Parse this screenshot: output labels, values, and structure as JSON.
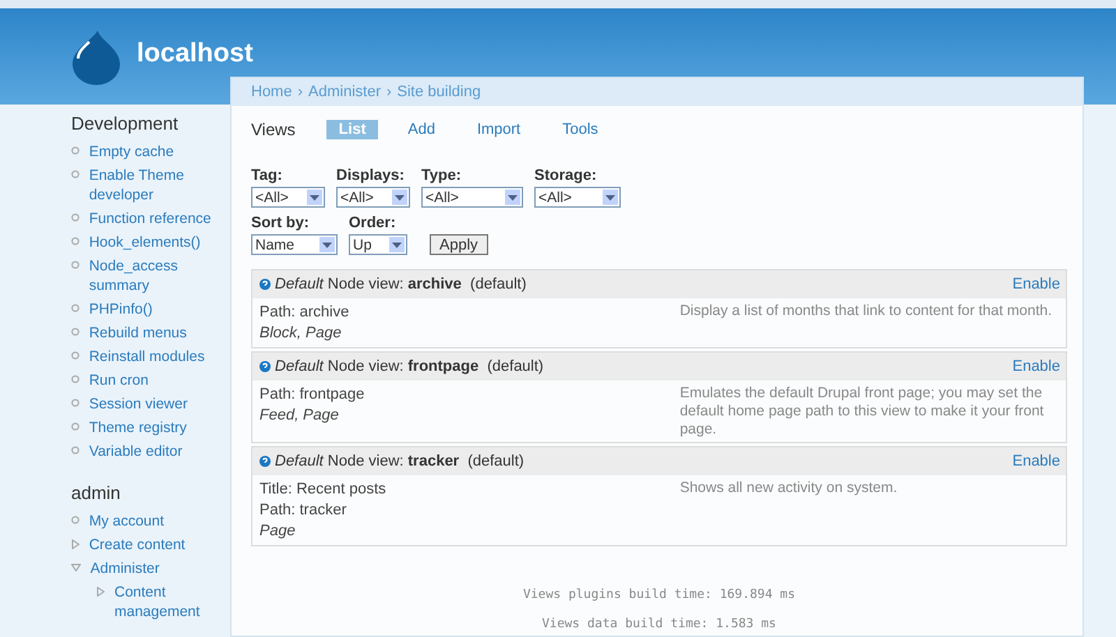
{
  "site": {
    "name": "localhost"
  },
  "sidebar": [
    {
      "title": "Development",
      "items": [
        {
          "label": "Empty cache",
          "kind": "leaf"
        },
        {
          "label": "Enable Theme developer",
          "kind": "leaf"
        },
        {
          "label": "Function reference",
          "kind": "leaf"
        },
        {
          "label": "Hook_elements()",
          "kind": "leaf"
        },
        {
          "label": "Node_access summary",
          "kind": "leaf"
        },
        {
          "label": "PHPinfo()",
          "kind": "leaf"
        },
        {
          "label": "Rebuild menus",
          "kind": "leaf"
        },
        {
          "label": "Reinstall modules",
          "kind": "leaf"
        },
        {
          "label": "Run cron",
          "kind": "leaf"
        },
        {
          "label": "Session viewer",
          "kind": "leaf"
        },
        {
          "label": "Theme registry",
          "kind": "leaf"
        },
        {
          "label": "Variable editor",
          "kind": "leaf"
        }
      ]
    },
    {
      "title": "admin",
      "items": [
        {
          "label": "My account",
          "kind": "leaf"
        },
        {
          "label": "Create content",
          "kind": "collapsed"
        },
        {
          "label": "Administer",
          "kind": "expanded",
          "children": [
            {
              "label": "Content management",
              "kind": "collapsed"
            }
          ]
        }
      ]
    }
  ],
  "breadcrumb": [
    "Home",
    "Administer",
    "Site building"
  ],
  "page_title": "Views",
  "tabs": [
    {
      "label": "List",
      "selected": true
    },
    {
      "label": "Add",
      "selected": false
    },
    {
      "label": "Import",
      "selected": false
    },
    {
      "label": "Tools",
      "selected": false
    }
  ],
  "breadcrumb_separators": [
    "›",
    "›"
  ],
  "filters": [
    [
      {
        "label": "Tag:",
        "value": "<All>"
      },
      {
        "label": "Displays:",
        "value": "<All>"
      },
      {
        "label": "Type:",
        "value": "<All>"
      },
      {
        "label": "Storage:",
        "value": "<All>"
      }
    ],
    [
      {
        "label": "Sort by:",
        "value": "Name"
      },
      {
        "label": "Order:",
        "value": "Up"
      }
    ]
  ],
  "apply_button": "Apply",
  "views": [
    {
      "type": "Default",
      "kind_label": "Node view:",
      "name": "archive",
      "status": "(default)",
      "action": "Enable",
      "details": [
        {
          "text": "Path: archive",
          "italic": false
        },
        {
          "text": "Block, Page",
          "italic": true
        }
      ],
      "description": "Display a list of months that link to content for that month."
    },
    {
      "type": "Default",
      "kind_label": "Node view:",
      "name": "frontpage",
      "status": "(default)",
      "action": "Enable",
      "details": [
        {
          "text": "Path: frontpage",
          "italic": false
        },
        {
          "text": "Feed, Page",
          "italic": true
        }
      ],
      "description": "Emulates the default Drupal front page; you may set the default home page path to this view to make it your front page."
    },
    {
      "type": "Default",
      "kind_label": "Node view:",
      "name": "tracker",
      "status": "(default)",
      "action": "Enable",
      "details": [
        {
          "text": "Title: Recent posts",
          "italic": false
        },
        {
          "text": "Path: tracker",
          "italic": false
        },
        {
          "text": "Page",
          "italic": true
        }
      ],
      "description": "Shows all new activity on system."
    }
  ],
  "footer": [
    "Views plugins build time: 169.894 ms",
    "Views data build time: 1.583 ms"
  ]
}
